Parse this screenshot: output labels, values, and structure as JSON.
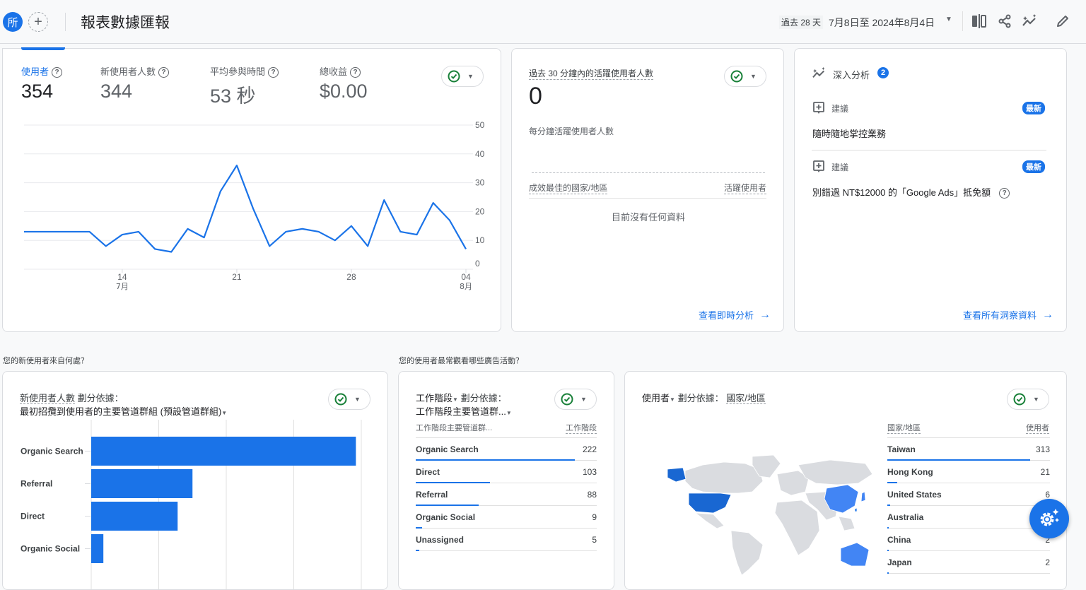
{
  "header": {
    "avatar_letter": "所",
    "add_symbol": "+",
    "title": "報表數據匯報",
    "date_chip": "過去 28 天",
    "date_range": "7月8日至 2024年8月4日",
    "icons": [
      "compare-icon",
      "share-icon",
      "insights-icon",
      "edit-icon"
    ]
  },
  "overview": {
    "metrics": [
      {
        "label": "使用者",
        "value": "354",
        "active": true
      },
      {
        "label": "新使用者人數",
        "value": "344",
        "active": false
      },
      {
        "label": "平均參與時間",
        "value": "53 秒",
        "active": false
      },
      {
        "label": "總收益",
        "value": "$0.00",
        "active": false
      }
    ]
  },
  "realtime": {
    "title": "過去 30 分鐘內的活躍使用者人數",
    "value": "0",
    "subtitle": "每分鐘活躍使用者人數",
    "col_country": "成效最佳的國家/地區",
    "col_users": "活躍使用者",
    "empty": "目前沒有任何資料",
    "link": "查看即時分析"
  },
  "insights": {
    "title": "深入分析",
    "count": "2",
    "items": [
      {
        "type": "建議",
        "badge": "最新",
        "text": "隨時隨地掌控業務"
      },
      {
        "type": "建議",
        "badge": "最新",
        "text": "別錯過 NT$12000 的「Google Ads」抵免額"
      }
    ],
    "link": "查看所有洞察資料"
  },
  "sections": {
    "q1": "您的新使用者來自何處？",
    "q2": "您的使用者最常觀看哪些廣告活動？"
  },
  "acquisition": {
    "metric": "新使用者人數",
    "by": "劃分依據：",
    "dimension": "最初招攬到使用者的主要管道群組 (預設管道群組)"
  },
  "sessions": {
    "metric": "工作階段",
    "by": "劃分依據：",
    "dimension": "工作階段主要管道群...",
    "col_name": "工作階段主要管道群...",
    "col_value": "工作階段",
    "rows": [
      {
        "name": "Organic Search",
        "value": 222
      },
      {
        "name": "Direct",
        "value": 103
      },
      {
        "name": "Referral",
        "value": 88
      },
      {
        "name": "Organic Social",
        "value": 9
      },
      {
        "name": "Unassigned",
        "value": 5
      }
    ]
  },
  "geo": {
    "metric": "使用者",
    "by": "劃分依據：",
    "dimension": "國家/地區",
    "col_name": "國家/地區",
    "col_value": "使用者",
    "rows": [
      {
        "name": "Taiwan",
        "value": 313
      },
      {
        "name": "Hong Kong",
        "value": 21
      },
      {
        "name": "United States",
        "value": 6
      },
      {
        "name": "Australia",
        "value": 2
      },
      {
        "name": "China",
        "value": 2
      },
      {
        "name": "Japan",
        "value": 2
      }
    ],
    "highlighted_countries": [
      "United States",
      "China",
      "Australia",
      "Japan",
      "Taiwan",
      "Hong Kong"
    ]
  },
  "colors": {
    "accent": "#1a73e8",
    "check_green": "#188038",
    "map_land": "#dadce0",
    "map_dark": "#1967d2",
    "map_light": "#4285f4"
  },
  "chart_data": [
    {
      "type": "line",
      "title": "使用者",
      "x": [
        "07-08",
        "07-09",
        "07-10",
        "07-11",
        "07-12",
        "07-13",
        "07-14",
        "07-15",
        "07-16",
        "07-17",
        "07-18",
        "07-19",
        "07-20",
        "07-21",
        "07-22",
        "07-23",
        "07-24",
        "07-25",
        "07-26",
        "07-27",
        "07-28",
        "07-29",
        "07-30",
        "07-31",
        "08-01",
        "08-02",
        "08-03",
        "08-04"
      ],
      "series": [
        {
          "name": "使用者",
          "values": [
            13,
            13,
            13,
            13,
            13,
            8,
            12,
            13,
            7,
            6,
            14,
            11,
            27,
            36,
            21,
            8,
            13,
            14,
            13,
            10,
            15,
            8,
            24,
            13,
            12,
            23,
            17,
            7
          ]
        }
      ],
      "x_ticks": [
        {
          "label": "14",
          "sub": "7月",
          "x": "07-14"
        },
        {
          "label": "21",
          "sub": "",
          "x": "07-21"
        },
        {
          "label": "28",
          "sub": "",
          "x": "07-28"
        },
        {
          "label": "04",
          "sub": "8月",
          "x": "08-04"
        }
      ],
      "y_ticks": [
        0,
        10,
        20,
        30,
        40,
        50
      ],
      "ylim": [
        0,
        50
      ],
      "grid": true,
      "legend": "none"
    },
    {
      "type": "bar",
      "orientation": "horizontal",
      "title": "新使用者人數 劃分依據：最初招攬到使用者的主要管道群組 (預設管道群組)",
      "categories": [
        "Organic Search",
        "Referral",
        "Direct",
        "Organic Social"
      ],
      "values": [
        196,
        75,
        64,
        9
      ],
      "xlim": [
        0,
        200
      ],
      "x_gridlines": [
        0,
        50,
        100,
        150,
        200
      ],
      "grid": true
    }
  ]
}
